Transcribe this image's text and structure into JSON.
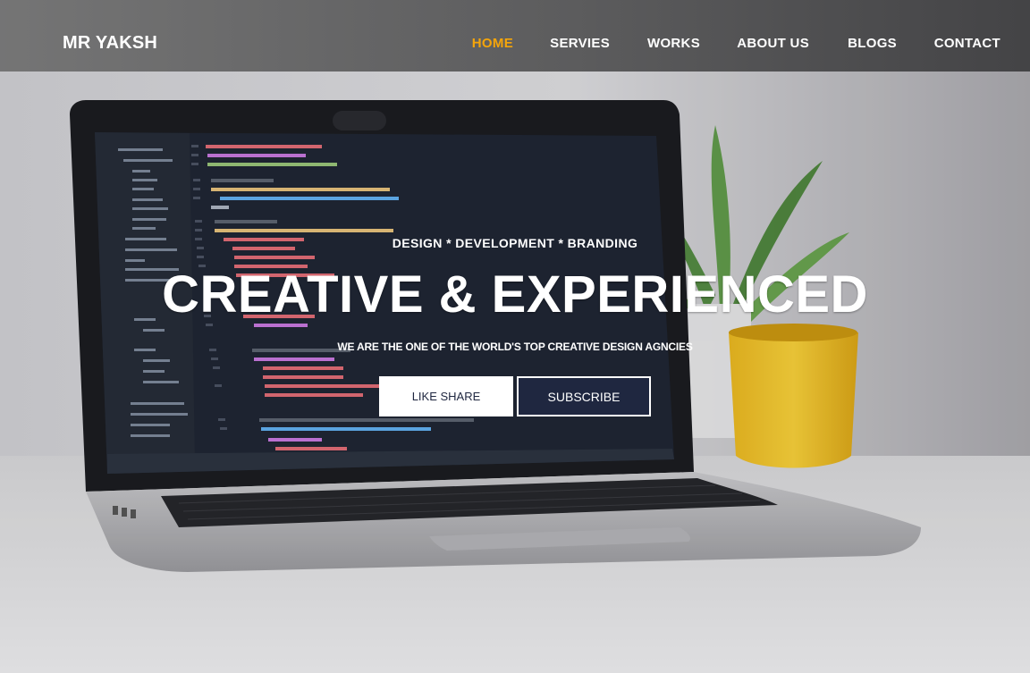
{
  "brand": {
    "name": "MR YAKSH"
  },
  "nav": {
    "items": [
      {
        "label": "HOME",
        "active": true
      },
      {
        "label": "SERVIES",
        "active": false
      },
      {
        "label": "WORKS",
        "active": false
      },
      {
        "label": "ABOUT US",
        "active": false
      },
      {
        "label": "BLOGS",
        "active": false
      },
      {
        "label": "CONTACT",
        "active": false
      }
    ]
  },
  "hero": {
    "tagline": "DESIGN * DEVELOPMENT * BRANDING",
    "headline": "CREATIVE & EXPERIENCED",
    "subline": "WE ARE THE ONE OF THE WORLD'S TOP CREATIVE DESIGN AGNCIES",
    "buttons": {
      "like_share": "LIKE SHARE",
      "subscribe": "SUBSCRIBE"
    }
  },
  "colors": {
    "accent": "#f5a50a",
    "button_dark": "#1f2740",
    "button_light": "#ffffff",
    "text": "#ffffff"
  }
}
